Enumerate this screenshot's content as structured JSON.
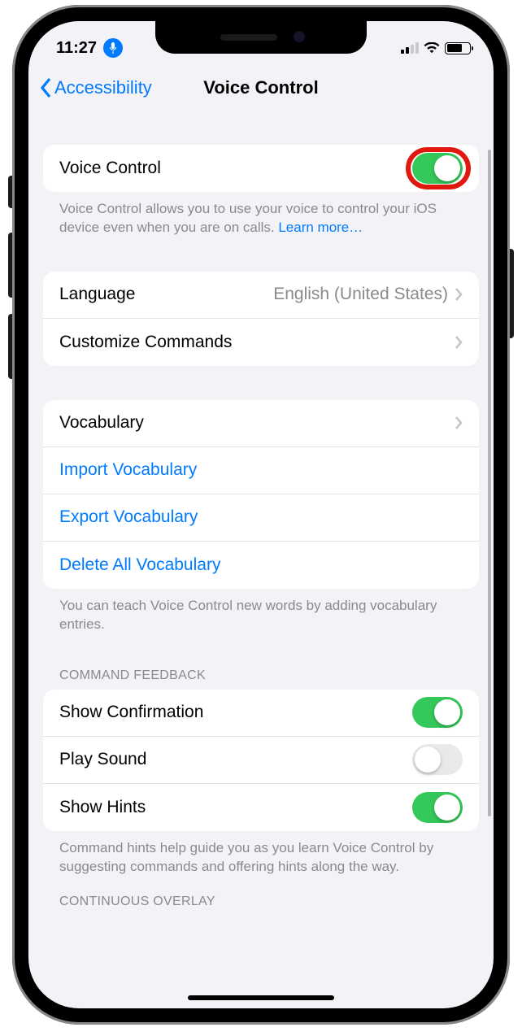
{
  "status": {
    "time": "11:27",
    "mic_icon": "mic"
  },
  "nav": {
    "back_label": "Accessibility",
    "title": "Voice Control"
  },
  "sections": {
    "main_toggle": {
      "label": "Voice Control",
      "on": true
    },
    "main_desc": "Voice Control allows you to use your voice to control your iOS device even when you are on calls. ",
    "main_desc_link": "Learn more…",
    "lang": {
      "label": "Language",
      "value": "English (United States)"
    },
    "custom_cmds": {
      "label": "Customize Commands"
    },
    "vocab": {
      "label": "Vocabulary"
    },
    "import_vocab": {
      "label": "Import Vocabulary"
    },
    "export_vocab": {
      "label": "Export Vocabulary"
    },
    "delete_vocab": {
      "label": "Delete All Vocabulary"
    },
    "vocab_desc": "You can teach Voice Control new words by adding vocabulary entries.",
    "cmd_feedback_header": "COMMAND FEEDBACK",
    "show_conf": {
      "label": "Show Confirmation",
      "on": true
    },
    "play_sound": {
      "label": "Play Sound",
      "on": false
    },
    "show_hints": {
      "label": "Show Hints",
      "on": true
    },
    "hints_desc": "Command hints help guide you as you learn Voice Control by suggesting commands and offering hints along the way.",
    "continuous_header": "CONTINUOUS OVERLAY"
  }
}
